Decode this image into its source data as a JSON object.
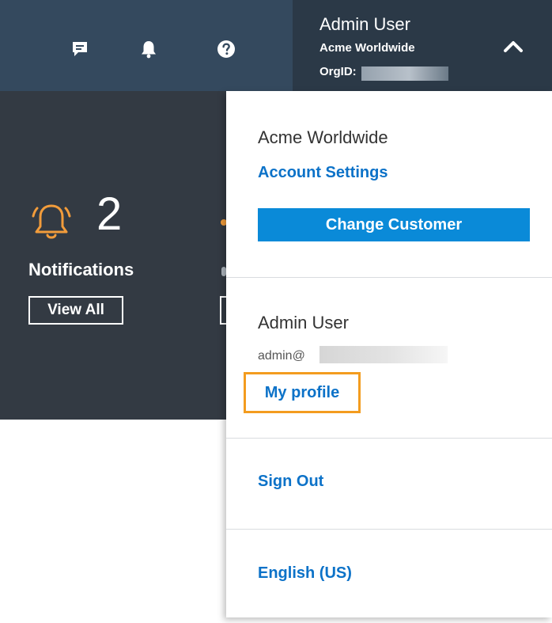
{
  "topbar": {
    "icons": {
      "feedback": "feedback-icon",
      "notifications": "bell-icon",
      "help": "help-icon"
    },
    "user": {
      "name": "Admin User",
      "org": "Acme Worldwide",
      "orgid_label": "OrgID:"
    }
  },
  "dashboard": {
    "notification_count": "2",
    "notifications_label": "Notifications",
    "view_all_label": "View All"
  },
  "menu": {
    "org_name": "Acme Worldwide",
    "account_settings": "Account Settings",
    "change_customer": "Change Customer",
    "user_name": "Admin User",
    "email_prefix": "admin@",
    "my_profile": "My profile",
    "sign_out": "Sign Out",
    "language": "English (US)"
  },
  "colors": {
    "topbar_bg": "#34495e",
    "user_block_bg": "#2b3947",
    "panel_bg": "#333a43",
    "link": "#0c72c8",
    "button": "#0a8ad8",
    "highlight": "#f39c1f",
    "bell_accent": "#f29c3b"
  }
}
